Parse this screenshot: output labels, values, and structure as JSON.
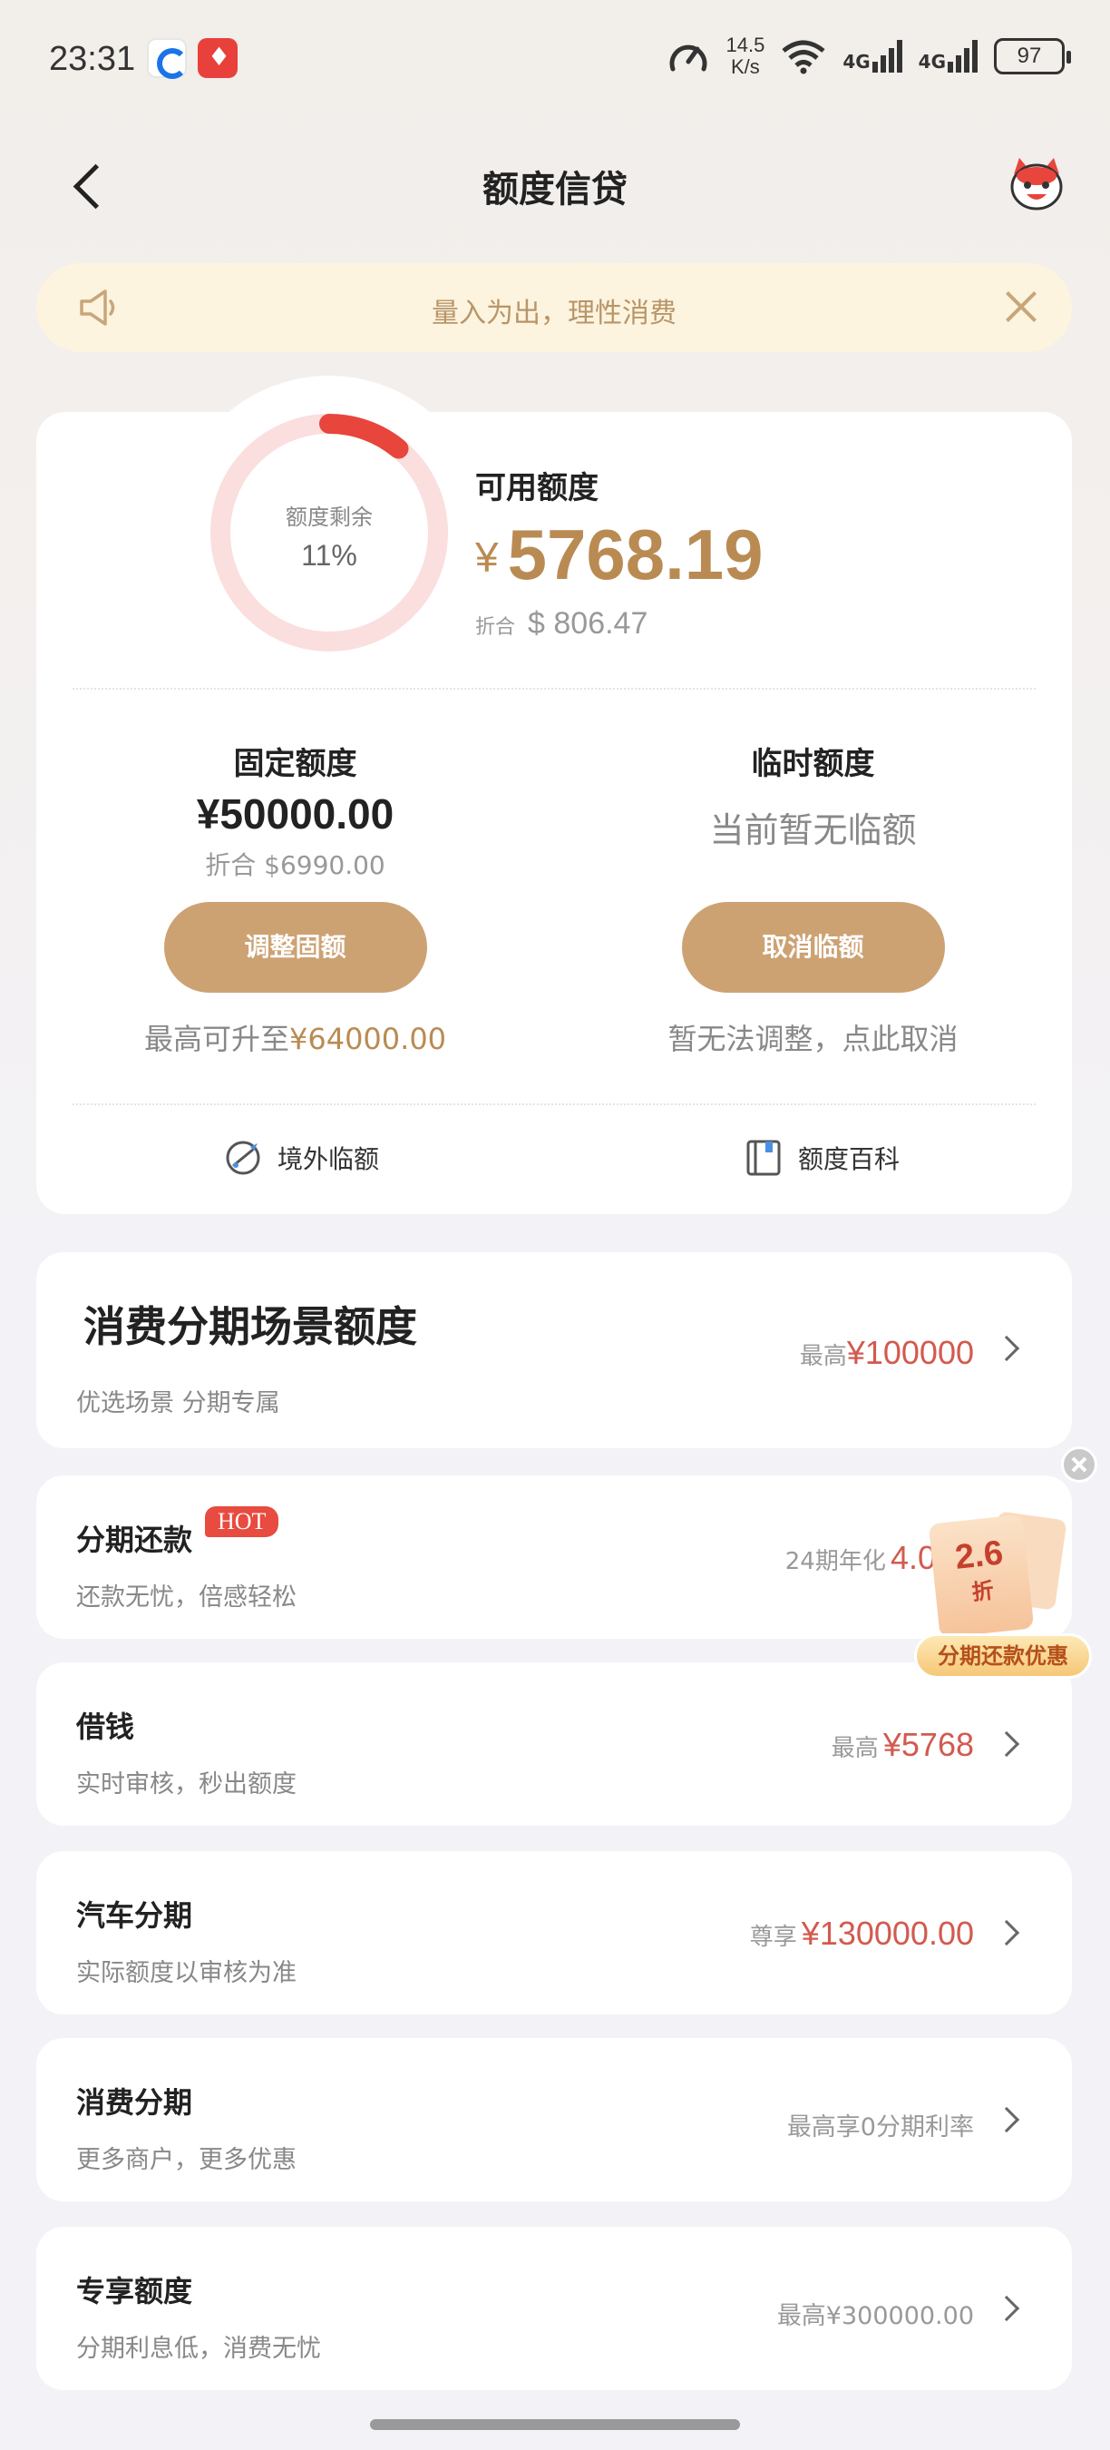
{
  "status_bar": {
    "time": "23:31",
    "net_speed_value": "14.5",
    "net_speed_unit": "K/s",
    "signal1": "4G",
    "signal2": "4G",
    "battery": "97"
  },
  "nav": {
    "title": "额度信贷"
  },
  "notice": {
    "text": "量入为出，理性消费"
  },
  "quota": {
    "ring_label": "额度剩余",
    "ring_percent": "11%",
    "ring_fraction": 0.11,
    "available_label": "可用额度",
    "available_currency": "¥",
    "available_amount": "5768.19",
    "converted_prefix": "折合",
    "converted_amount": "$ 806.47",
    "fixed": {
      "title": "固定额度",
      "amount": "¥50000.00",
      "converted": "折合 $6990.00",
      "button": "调整固额",
      "note_prefix": "最高可升至",
      "note_value": "¥64000.00"
    },
    "temporary": {
      "title": "临时额度",
      "status": "当前暂无临额",
      "button": "取消临额",
      "note": "暂无法调整，点此取消"
    },
    "links": {
      "overseas": "境外临额",
      "wiki": "额度百科"
    }
  },
  "scene_card": {
    "title": "消费分期场景额度",
    "subtitle": "优选场景 分期专属",
    "right_prefix": "最高",
    "right_amount": "¥100000"
  },
  "items": [
    {
      "title": "分期还款",
      "badge": "HOT",
      "subtitle": "还款无忧，倍感轻松",
      "right_prefix": "24期年化",
      "right_amount": "4.0"
    },
    {
      "title": "借钱",
      "subtitle": "实时审核，秒出额度",
      "right_prefix": "最高",
      "right_amount": "¥5768"
    },
    {
      "title": "汽车分期",
      "subtitle": "实际额度以审核为准",
      "right_prefix": "尊享",
      "right_amount": "¥130000.00"
    },
    {
      "title": "消费分期",
      "subtitle": "更多商户，更多优惠",
      "right_text": "最高享0分期利率"
    },
    {
      "title": "专享额度",
      "subtitle": "分期利息低，消费无忧",
      "right_text": "最高¥300000.00"
    }
  ],
  "promo": {
    "discount": "2.6",
    "discount_unit": "折",
    "label": "分期还款优惠"
  },
  "colors": {
    "gold": "#cda273",
    "gold_text": "#b98b53",
    "red_amount": "#d25a4f",
    "ring_track": "#fbdede",
    "ring_fill": "#e8453c"
  }
}
